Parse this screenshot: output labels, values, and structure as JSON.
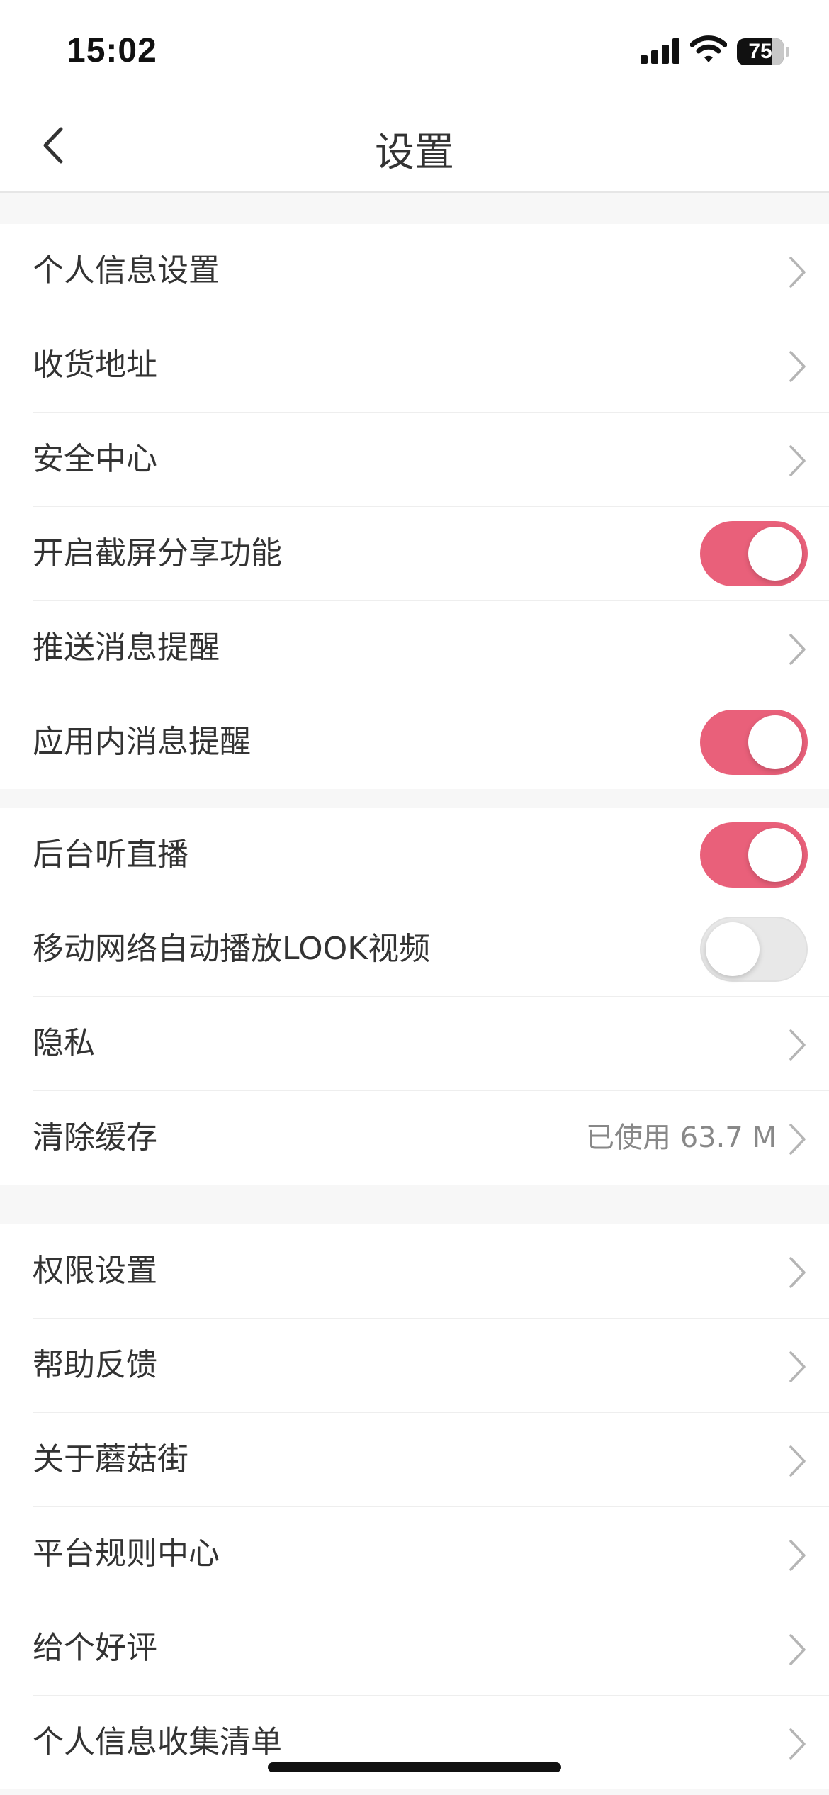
{
  "status": {
    "time": "15:02",
    "battery": "75"
  },
  "nav": {
    "title": "设置"
  },
  "section1": [
    {
      "label": "个人信息设置",
      "type": "link"
    },
    {
      "label": "收货地址",
      "type": "link"
    },
    {
      "label": "安全中心",
      "type": "link"
    },
    {
      "label": "开启截屏分享功能",
      "type": "toggle",
      "on": true
    },
    {
      "label": "推送消息提醒",
      "type": "link"
    },
    {
      "label": "应用内消息提醒",
      "type": "toggle",
      "on": true
    }
  ],
  "section2": [
    {
      "label": "后台听直播",
      "type": "toggle",
      "on": true
    },
    {
      "label": "移动网络自动播放LOOK视频",
      "type": "toggle",
      "on": false
    },
    {
      "label": "隐私",
      "type": "link"
    },
    {
      "label": "清除缓存",
      "type": "link",
      "value": "已使用 63.7 M"
    }
  ],
  "section3": [
    {
      "label": "权限设置",
      "type": "link"
    },
    {
      "label": "帮助反馈",
      "type": "link"
    },
    {
      "label": "关于蘑菇街",
      "type": "link"
    },
    {
      "label": "平台规则中心",
      "type": "link"
    },
    {
      "label": "给个好评",
      "type": "link"
    },
    {
      "label": "个人信息收集清单",
      "type": "link"
    }
  ],
  "colors": {
    "toggle_on": "#e9607a",
    "toggle_off": "#e8e8e8"
  }
}
